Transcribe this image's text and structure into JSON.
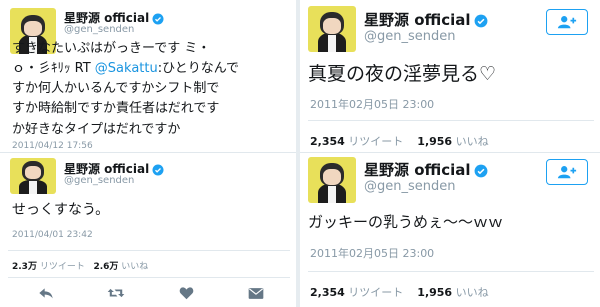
{
  "colors": {
    "accent": "#1da1f2",
    "link": "#1b95e0",
    "muted": "#8899a6",
    "avatar_bg": "#e8e05a"
  },
  "tweets": [
    {
      "name": "星野源 official",
      "handle": "@gen_senden",
      "text_lines": [
        "すきなたいぷはがっきーです ミ・",
        "ｏ・彡ｷﾘｯ RT ",
        "すか何人かいるんですかシフト制で",
        "すか時給制ですか責任者はだれです",
        "か好きなタイプはだれですか"
      ],
      "mention": "@Sakattu",
      "after_mention": ":ひとりなんで",
      "time": "2011/04/12 17:56"
    },
    {
      "name": "星野源 official",
      "handle": "@gen_senden",
      "text": "せっくすなう。",
      "time": "2011/04/01 23:42",
      "retweets": "2.3万",
      "retweets_label": "リツイート",
      "likes": "2.6万",
      "likes_label": "いいね",
      "actions": [
        "reply-icon",
        "retweet-icon",
        "like-icon",
        "mail-icon"
      ]
    },
    {
      "name": "星野源 official",
      "handle": "@gen_senden",
      "text": "真夏の夜の淫夢見る♡",
      "time": "2011年02月05日 23:00",
      "retweets": "2,354",
      "retweets_label": "リツイート",
      "likes": "1,956",
      "likes_label": "いいね",
      "follow_icon": "follow-user-icon"
    },
    {
      "name": "星野源 official",
      "handle": "@gen_senden",
      "text": "ガッキーの乳うめぇ〜〜ｗｗ",
      "time": "2011年02月05日 23:00",
      "retweets": "2,354",
      "retweets_label": "リツイート",
      "likes": "1,956",
      "likes_label": "いいね",
      "follow_icon": "follow-user-icon"
    }
  ]
}
